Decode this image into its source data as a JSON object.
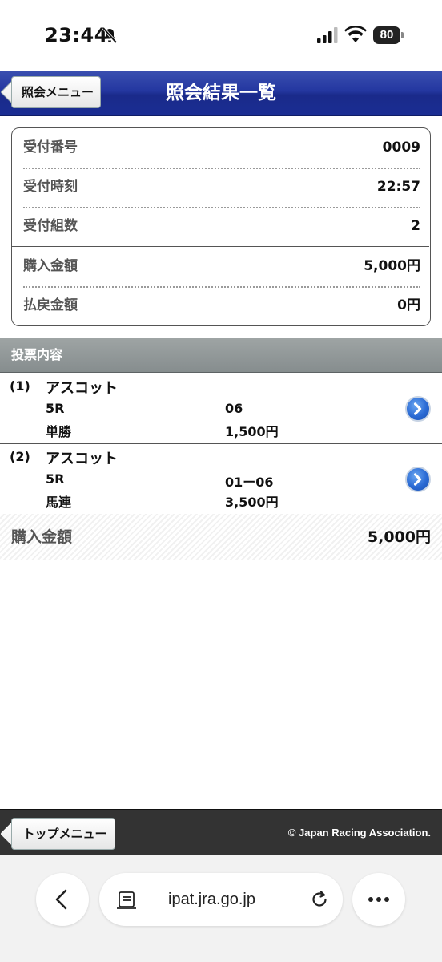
{
  "status_bar": {
    "time": "23:44",
    "battery": "80",
    "icons": [
      "bell-slash-icon",
      "signal-icon",
      "wifi-icon",
      "battery-icon"
    ]
  },
  "header": {
    "back_label": "照会メニュー",
    "title": "照会結果一覧",
    "colors": {
      "bar": "#2437a0",
      "accent": "#1a2a8a"
    }
  },
  "summary": {
    "rows": [
      {
        "label": "受付番号",
        "value": "0009"
      },
      {
        "label": "受付時刻",
        "value": "22:57"
      },
      {
        "label": "受付組数",
        "value": "2"
      },
      {
        "label": "購入金額",
        "value": "5,000円"
      },
      {
        "label": "払戻金額",
        "value": "0円"
      }
    ]
  },
  "section": {
    "title": "投票内容"
  },
  "bets": [
    {
      "num": "(1)",
      "venue": "アスコット",
      "race": "5R",
      "type": "単勝",
      "horse": "06",
      "amount": "1,500円",
      "icon": "chevron-right-icon"
    },
    {
      "num": "(2)",
      "venue": "アスコット",
      "race": "5R",
      "type": "馬連",
      "horse": "01ー06",
      "amount": "3,500円",
      "icon": "chevron-right-icon"
    }
  ],
  "total": {
    "label": "購入金額",
    "value": "5,000円"
  },
  "footer": {
    "top_label": "トップメニュー",
    "copyright": "© Japan Racing Association."
  },
  "browser": {
    "url": "ipat.jra.go.jp",
    "icons": [
      "back-icon",
      "reader-icon",
      "reload-icon",
      "more-icon"
    ]
  }
}
